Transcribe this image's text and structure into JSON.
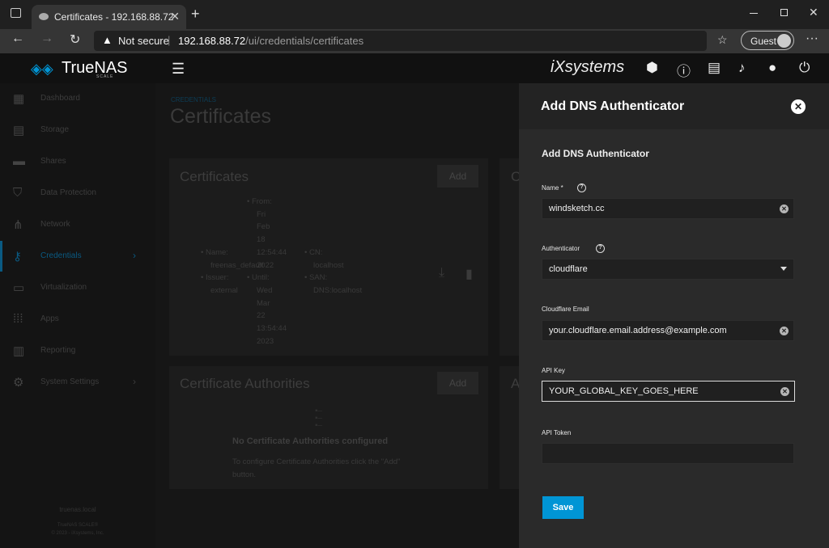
{
  "browser": {
    "tab_title": "Certificates - 192.168.88.72",
    "not_secure": "Not secure",
    "url_host": "192.168.88.72",
    "url_path": "/ui/credentials/certificates",
    "profile": "Guest"
  },
  "app": {
    "logo_name": "TrueNAS",
    "logo_edition": "SCALE",
    "vendor": "iXsystems"
  },
  "sidebar": {
    "items": [
      {
        "label": "Dashboard",
        "icon": "dashboard-icon"
      },
      {
        "label": "Storage",
        "icon": "storage-icon"
      },
      {
        "label": "Shares",
        "icon": "shares-icon"
      },
      {
        "label": "Data Protection",
        "icon": "shield-icon"
      },
      {
        "label": "Network",
        "icon": "network-icon"
      },
      {
        "label": "Credentials",
        "icon": "key-icon"
      },
      {
        "label": "Virtualization",
        "icon": "monitor-icon"
      },
      {
        "label": "Apps",
        "icon": "apps-icon"
      },
      {
        "label": "Reporting",
        "icon": "chart-icon"
      },
      {
        "label": "System Settings",
        "icon": "gear-icon"
      }
    ],
    "hostname": "truenas.local",
    "footer_line1": "TrueNAS SCALE®",
    "footer_line2": "© 2023 - iXsystems, Inc."
  },
  "main": {
    "breadcrumb": "CREDENTIALS",
    "page_title": "Certificates",
    "certificates_card": {
      "title": "Certificates",
      "add_label": "Add",
      "name_label": "Name:",
      "name_value": "freenas_default",
      "issuer_label": "Issuer:",
      "issuer_value": "external",
      "from_label": "From:",
      "from_value": [
        "Fri",
        "Feb",
        "18",
        "12:54:44",
        "2022"
      ],
      "until_label": "Until:",
      "until_value": [
        "Wed",
        "Mar",
        "22",
        "13:54:44",
        "2023"
      ],
      "cn_label": "CN:",
      "cn_value": "localhost",
      "san_label": "SAN:",
      "san_value": "DNS:localhost"
    },
    "ca_card": {
      "title": "Certificate Authorities",
      "add_label": "Add",
      "empty_title": "No Certificate Authorities configured",
      "empty_text_1": "To configure Certificate Authorities click the \"Add\"",
      "empty_text_2": "button."
    },
    "partial_card_letter_1": "C",
    "partial_card_letter_2": "A"
  },
  "panel": {
    "title": "Add DNS Authenticator",
    "section_title": "Add DNS Authenticator",
    "name_label": "Name *",
    "name_value": "windsketch.cc",
    "authenticator_label": "Authenticator",
    "authenticator_value": "cloudflare",
    "email_label": "Cloudflare Email",
    "email_value": "your.cloudflare.email.address@example.com",
    "api_key_label": "API Key",
    "api_key_value": "YOUR_GLOBAL_KEY_GOES_HERE",
    "api_token_label": "API Token",
    "api_token_value": "",
    "save_label": "Save",
    "accent": "#0095d5"
  }
}
